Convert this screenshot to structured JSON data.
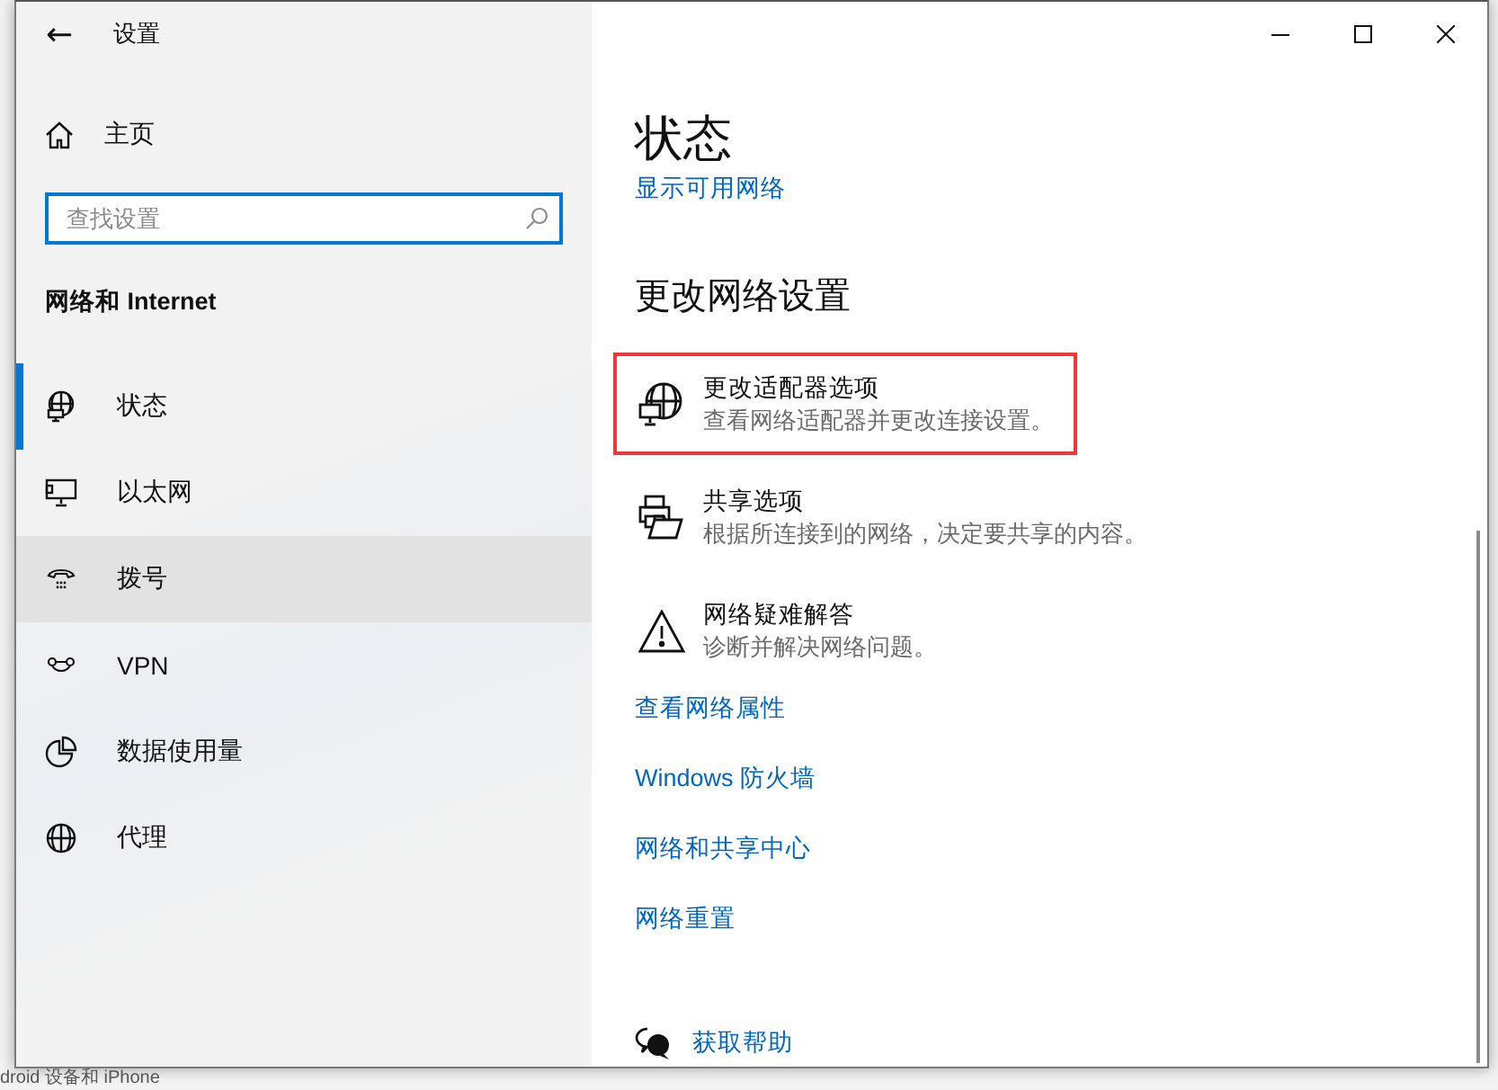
{
  "window": {
    "title": "设置",
    "back": "←"
  },
  "sidebar": {
    "home": "主页",
    "search": {
      "placeholder": "查找设置"
    },
    "section": "网络和 Internet",
    "items": [
      {
        "label": "状态",
        "selected": true,
        "hovered": false
      },
      {
        "label": "以太网",
        "selected": false,
        "hovered": false
      },
      {
        "label": "拨号",
        "selected": false,
        "hovered": true
      },
      {
        "label": "VPN",
        "selected": false,
        "hovered": false
      },
      {
        "label": "数据使用量",
        "selected": false,
        "hovered": false
      },
      {
        "label": "代理",
        "selected": false,
        "hovered": false
      }
    ]
  },
  "content": {
    "title": "状态",
    "top_link": "显示可用网络",
    "section": "更改网络设置",
    "options": [
      {
        "title": "更改适配器选项",
        "description": "查看网络适配器并更改连接设置。",
        "highlighted": true
      },
      {
        "title": "共享选项",
        "description": "根据所连接到的网络，决定要共享的内容。",
        "highlighted": false
      },
      {
        "title": "网络疑难解答",
        "description": "诊断并解决网络问题。",
        "highlighted": false
      }
    ],
    "links": [
      "查看网络属性",
      "Windows 防火墙",
      "网络和共享中心",
      "网络重置"
    ],
    "help": "获取帮助"
  },
  "background_window": {
    "text": "droid 设备和 iPhone"
  }
}
